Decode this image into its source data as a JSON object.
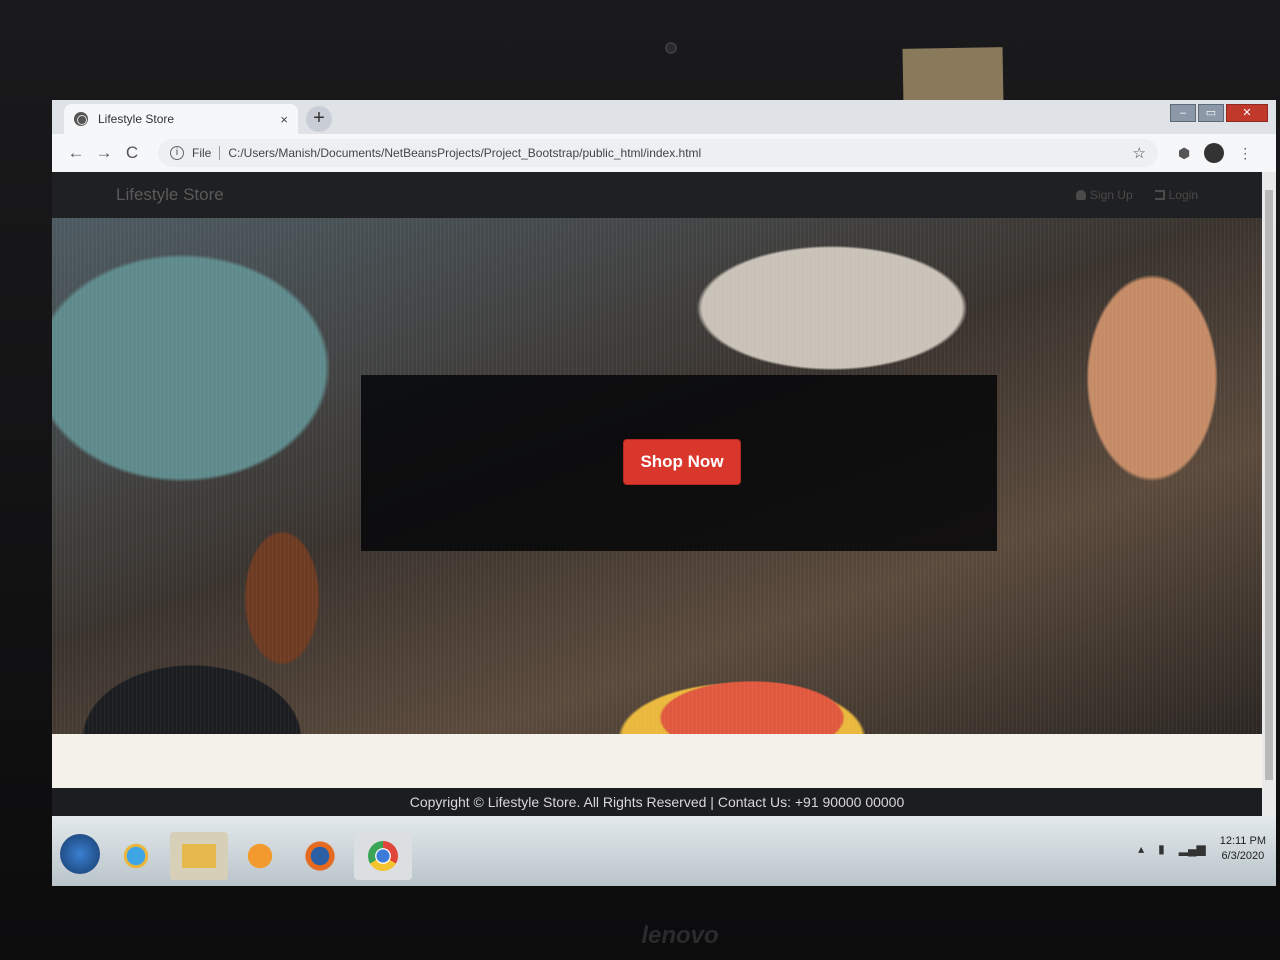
{
  "browser": {
    "tab_title": "Lifestyle Store",
    "tab_close": "×",
    "new_tab": "+",
    "address_scheme": "File",
    "address_url": "C:/Users/Manish/Documents/NetBeansProjects/Project_Bootstrap/public_html/index.html",
    "back": "←",
    "forward": "→",
    "reload": "C",
    "star": "☆"
  },
  "site": {
    "brand": "Lifestyle Store",
    "nav": {
      "signup": "Sign Up",
      "login": "Login"
    },
    "cta": "Shop Now",
    "footer": "Copyright © Lifestyle Store. All Rights Reserved | Contact Us: +91 90000 00000"
  },
  "taskbar": {
    "time": "12:11 PM",
    "date": "6/3/2020"
  }
}
